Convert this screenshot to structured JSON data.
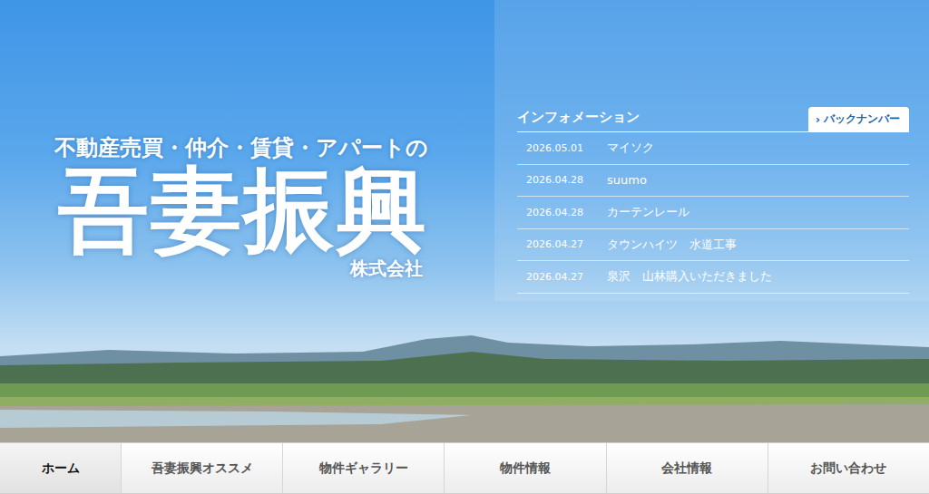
{
  "hero": {
    "tagline": "不動産売買・仲介・賃貸・アパートの",
    "company_name": "吾妻振興",
    "company_suffix": "株式会社"
  },
  "information": {
    "title": "インフォメーション",
    "back_number_button": {
      "icon": "›",
      "label": "バックナンバー"
    },
    "items": [
      {
        "date": "2026.05.01",
        "title": "マイソク"
      },
      {
        "date": "2026.04.28",
        "title": "suumo"
      },
      {
        "date": "2026.04.28",
        "title": "カーテンレール"
      },
      {
        "date": "2026.04.27",
        "title": "タウンハイツ　水道工事"
      },
      {
        "date": "2026.04.27",
        "title": "泉沢　山林購入いただきました"
      }
    ]
  },
  "nav": [
    {
      "label": "ホーム",
      "selected": true
    },
    {
      "label": "吾妻振興オススメ",
      "selected": false
    },
    {
      "label": "物件ギャラリー",
      "selected": false
    },
    {
      "label": "物件情報",
      "selected": false
    },
    {
      "label": "会社情報",
      "selected": false
    },
    {
      "label": "お問い合わせ",
      "selected": false
    }
  ]
}
